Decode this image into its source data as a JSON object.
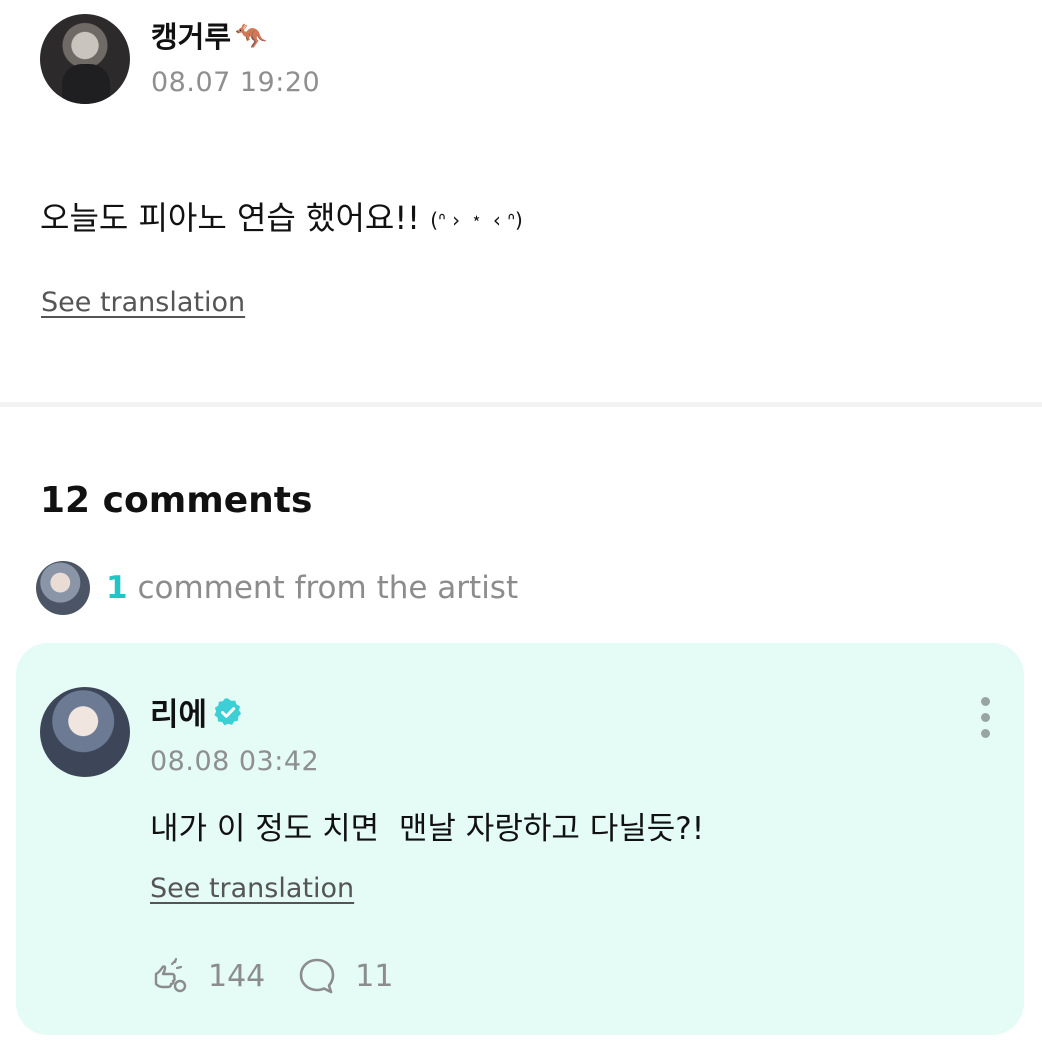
{
  "post": {
    "author_name": "캥거루",
    "author_emoji": "🦘",
    "timestamp": "08.07 19:20",
    "body_text": "오늘도 피아노 연습 했어요!! ",
    "body_kaomoji": "(ᐢ › ﹡ ‹ ᐢ)",
    "see_translation": "See translation"
  },
  "comments": {
    "title": "12 comments",
    "artist_count": "1",
    "artist_label": "comment from the artist",
    "card": {
      "author_name": "리에",
      "timestamp": "08.08 03:42",
      "body": "내가 이 정도 치면  맨날 자랑하고 다닐듯?!",
      "see_translation": "See translation",
      "like_count": "144",
      "reply_count": "11"
    }
  },
  "colors": {
    "accent": "#22c4c4",
    "card_bg": "#e4fbf6",
    "muted_text": "#8f8f8f"
  },
  "icons": [
    "verified-icon",
    "more-vertical-icon",
    "like-icon",
    "reply-icon"
  ]
}
